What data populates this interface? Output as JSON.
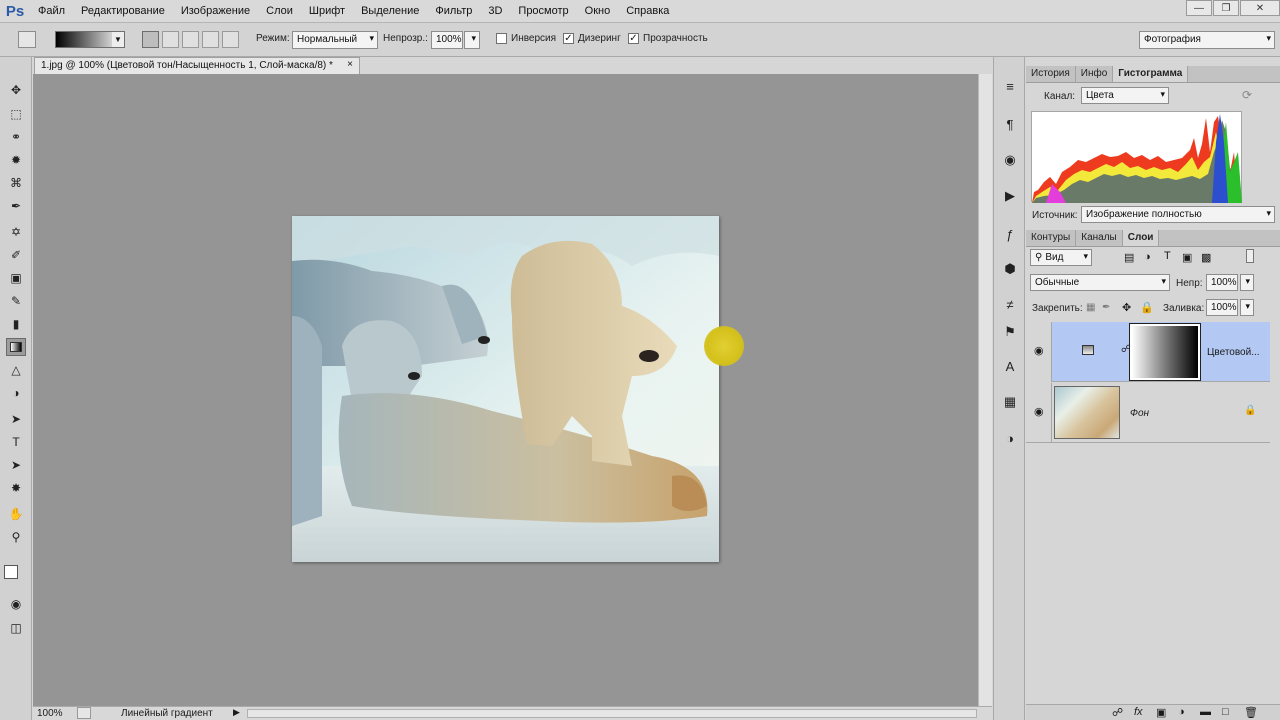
{
  "app": {
    "logo": "Ps"
  },
  "menu": [
    "Файл",
    "Редактирование",
    "Изображение",
    "Слои",
    "Шрифт",
    "Выделение",
    "Фильтр",
    "3D",
    "Просмотр",
    "Окно",
    "Справка"
  ],
  "options": {
    "mode_label": "Режим:",
    "mode_value": "Нормальный",
    "opacity_label": "Непрозр.:",
    "opacity_value": "100%",
    "inverse_label": "Инверсия",
    "inverse_checked": false,
    "dither_label": "Дизеринг",
    "dither_checked": true,
    "transparency_label": "Прозрачность",
    "transparency_checked": true,
    "workspace": "Фотография"
  },
  "document": {
    "tab_title": "1.jpg @ 100% (Цветовой тон/Насыщенность 1, Слой-маска/8) *",
    "zoom": "100%",
    "status": "Линейный градиент"
  },
  "histogram_panel": {
    "tabs": [
      "История",
      "Инфо",
      "Гистограмма"
    ],
    "active_tab": "Гистограмма",
    "channel_label": "Канал:",
    "channel_value": "Цвета",
    "source_label": "Источник:",
    "source_value": "Изображение полностью"
  },
  "layers_panel": {
    "tabs": [
      "Контуры",
      "Каналы",
      "Слои"
    ],
    "active_tab": "Слои",
    "filter_value": "Вид",
    "blend_mode": "Обычные",
    "opacity_label": "Непр:",
    "opacity_value": "100%",
    "lock_label": "Закрепить:",
    "fill_label": "Заливка:",
    "fill_value": "100%",
    "layers": [
      {
        "name": "Цветовой...",
        "selected": true
      },
      {
        "name": "Фон",
        "selected": false
      }
    ]
  },
  "colors": {
    "selected_layer": "#b3c9f4",
    "canvas_bg": "#959595"
  }
}
